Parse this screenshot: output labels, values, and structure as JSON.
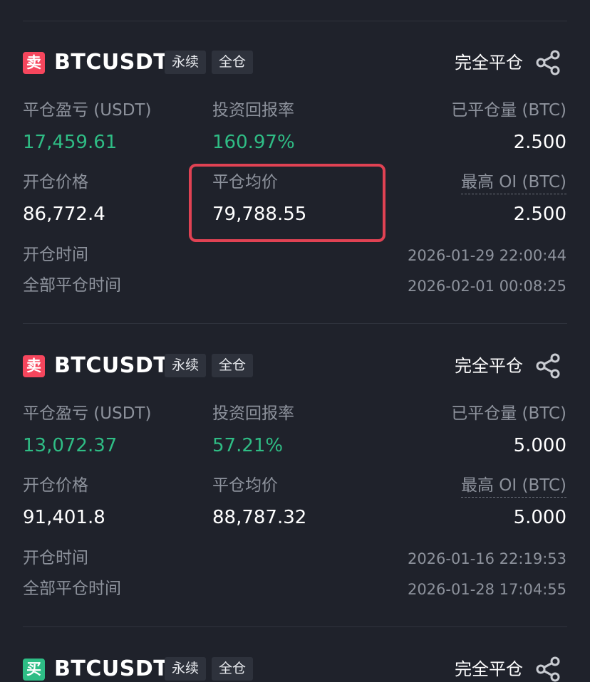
{
  "colors": {
    "background": "#1f222b",
    "sell": "#f6465d",
    "buy": "#2ebd85",
    "profit": "#2fbd85",
    "highlight": "#e04253"
  },
  "positions": [
    {
      "side": "卖",
      "side_color": "#f6465d",
      "symbol": "BTCUSDT",
      "type_tag": "永续",
      "margin_tag": "全仓",
      "close_type": "完全平仓",
      "share_icon": "share-icon",
      "pnl_label": "平仓盈亏 (USDT)",
      "pnl_value": "17,459.61",
      "roi_label": "投资回报率",
      "roi_value": "160.97%",
      "closed_qty_label": "已平仓量 (BTC)",
      "closed_qty_value": "2.500",
      "open_price_label": "开仓价格",
      "open_price_value": "86,772.4",
      "close_avg_label": "平仓均价",
      "close_avg_value": "79,788.55",
      "max_oi_label": "最高 OI (BTC)",
      "max_oi_value": "2.500",
      "open_time_label": "开仓时间",
      "open_time_value": "2026-01-29 22:00:44",
      "close_time_label": "全部平仓时间",
      "close_time_value": "2026-02-01 00:08:25"
    },
    {
      "side": "卖",
      "side_color": "#f6465d",
      "symbol": "BTCUSDT",
      "type_tag": "永续",
      "margin_tag": "全仓",
      "close_type": "完全平仓",
      "share_icon": "share-icon",
      "pnl_label": "平仓盈亏 (USDT)",
      "pnl_value": "13,072.37",
      "roi_label": "投资回报率",
      "roi_value": "57.21%",
      "closed_qty_label": "已平仓量 (BTC)",
      "closed_qty_value": "5.000",
      "open_price_label": "开仓价格",
      "open_price_value": "91,401.8",
      "close_avg_label": "平仓均价",
      "close_avg_value": "88,787.32",
      "max_oi_label": "最高 OI (BTC)",
      "max_oi_value": "5.000",
      "open_time_label": "开仓时间",
      "open_time_value": "2026-01-16 22:19:53",
      "close_time_label": "全部平仓时间",
      "close_time_value": "2026-01-28 17:04:55"
    },
    {
      "side": "买",
      "side_color": "#2ebd85",
      "symbol": "BTCUSDT",
      "type_tag": "永续",
      "margin_tag": "全仓",
      "close_type": "完全平仓",
      "share_icon": "share-icon"
    }
  ]
}
